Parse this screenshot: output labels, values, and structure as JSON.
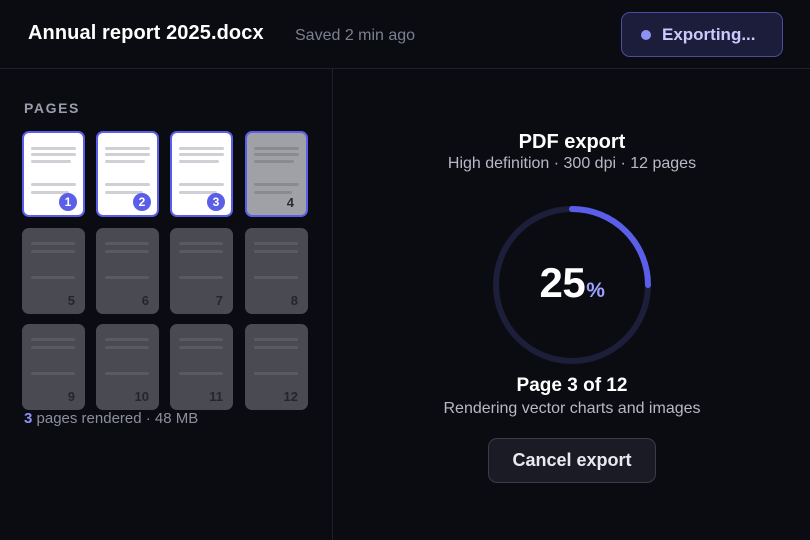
{
  "header": {
    "doc_title": "Annual report 2025.docx",
    "saved_status": "Saved 2 min ago",
    "export_button_label": "Exporting...",
    "export_dot_icon": "status-dot-icon"
  },
  "sidebar": {
    "heading": "PAGES",
    "pages": [
      {
        "number": "1",
        "state": "rendered"
      },
      {
        "number": "2",
        "state": "rendered"
      },
      {
        "number": "3",
        "state": "rendered"
      },
      {
        "number": "4",
        "state": "rendering"
      },
      {
        "number": "5",
        "state": "pending"
      },
      {
        "number": "6",
        "state": "pending"
      },
      {
        "number": "7",
        "state": "pending"
      },
      {
        "number": "8",
        "state": "pending"
      },
      {
        "number": "9",
        "state": "pending"
      },
      {
        "number": "10",
        "state": "pending"
      },
      {
        "number": "11",
        "state": "pending"
      },
      {
        "number": "12",
        "state": "pending"
      }
    ],
    "summary": {
      "count": "3",
      "text": " pages rendered · 48 MB"
    }
  },
  "main": {
    "title": "PDF export",
    "subtitle": "High definition · 300 dpi · 12 pages",
    "progress_percent": 25,
    "percent_value": "25",
    "percent_sign": "%",
    "page_progress": "Page 3 of 12",
    "detail": "Rendering vector charts and images",
    "cancel_label": "Cancel export"
  },
  "colors": {
    "accent": "#5b5ee8",
    "accent_light": "#8f91f5",
    "background": "#0b0c12",
    "ring_track": "#1d1e3a"
  }
}
